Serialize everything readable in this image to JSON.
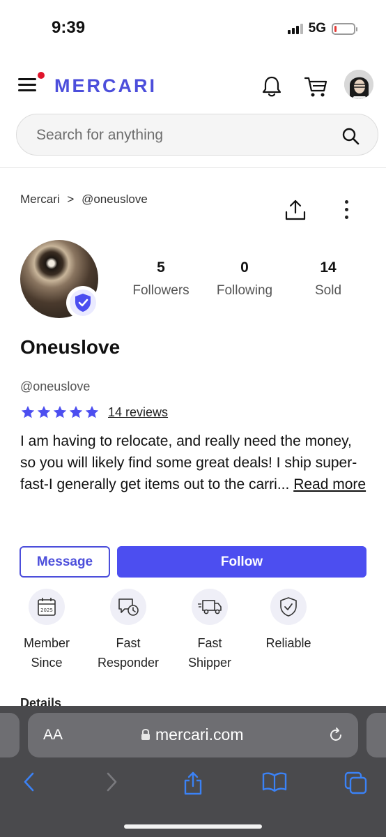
{
  "status_bar": {
    "time": "9:39",
    "network": "5G",
    "battery_level": 0.1
  },
  "header": {
    "logo": "MERCARI",
    "brand_color": "#4c4edb",
    "notification_dot_color": "#e0142b"
  },
  "search": {
    "placeholder": "Search for anything"
  },
  "breadcrumb": {
    "root": "Mercari",
    "separator": ">",
    "current": "@oneuslove"
  },
  "profile": {
    "verified": true,
    "stats": [
      {
        "value": "5",
        "label": "Followers"
      },
      {
        "value": "0",
        "label": "Following"
      },
      {
        "value": "14",
        "label": "Sold"
      }
    ],
    "display_name": "Oneuslove",
    "handle": "@oneuslove",
    "rating_stars": 5,
    "reviews_label": "14 reviews",
    "bio": "I am having to relocate, and really need the money, so you will likely find some great deals! I ship super-fast-I generally get items out to the carri...",
    "read_more": "Read more"
  },
  "actions": {
    "message_label": "Message",
    "follow_label": "Follow",
    "accent_color": "#4c4ef0"
  },
  "badges": [
    {
      "icon": "calendar-icon",
      "label": "Member Since",
      "calendar_year": "2025"
    },
    {
      "icon": "chat-clock-icon",
      "label": "Fast Responder"
    },
    {
      "icon": "truck-icon",
      "label": "Fast Shipper"
    },
    {
      "icon": "shield-check-icon",
      "label": "Reliable"
    }
  ],
  "details_peek": "Details",
  "browser": {
    "aa_label": "AA",
    "url": "mercari.com"
  }
}
